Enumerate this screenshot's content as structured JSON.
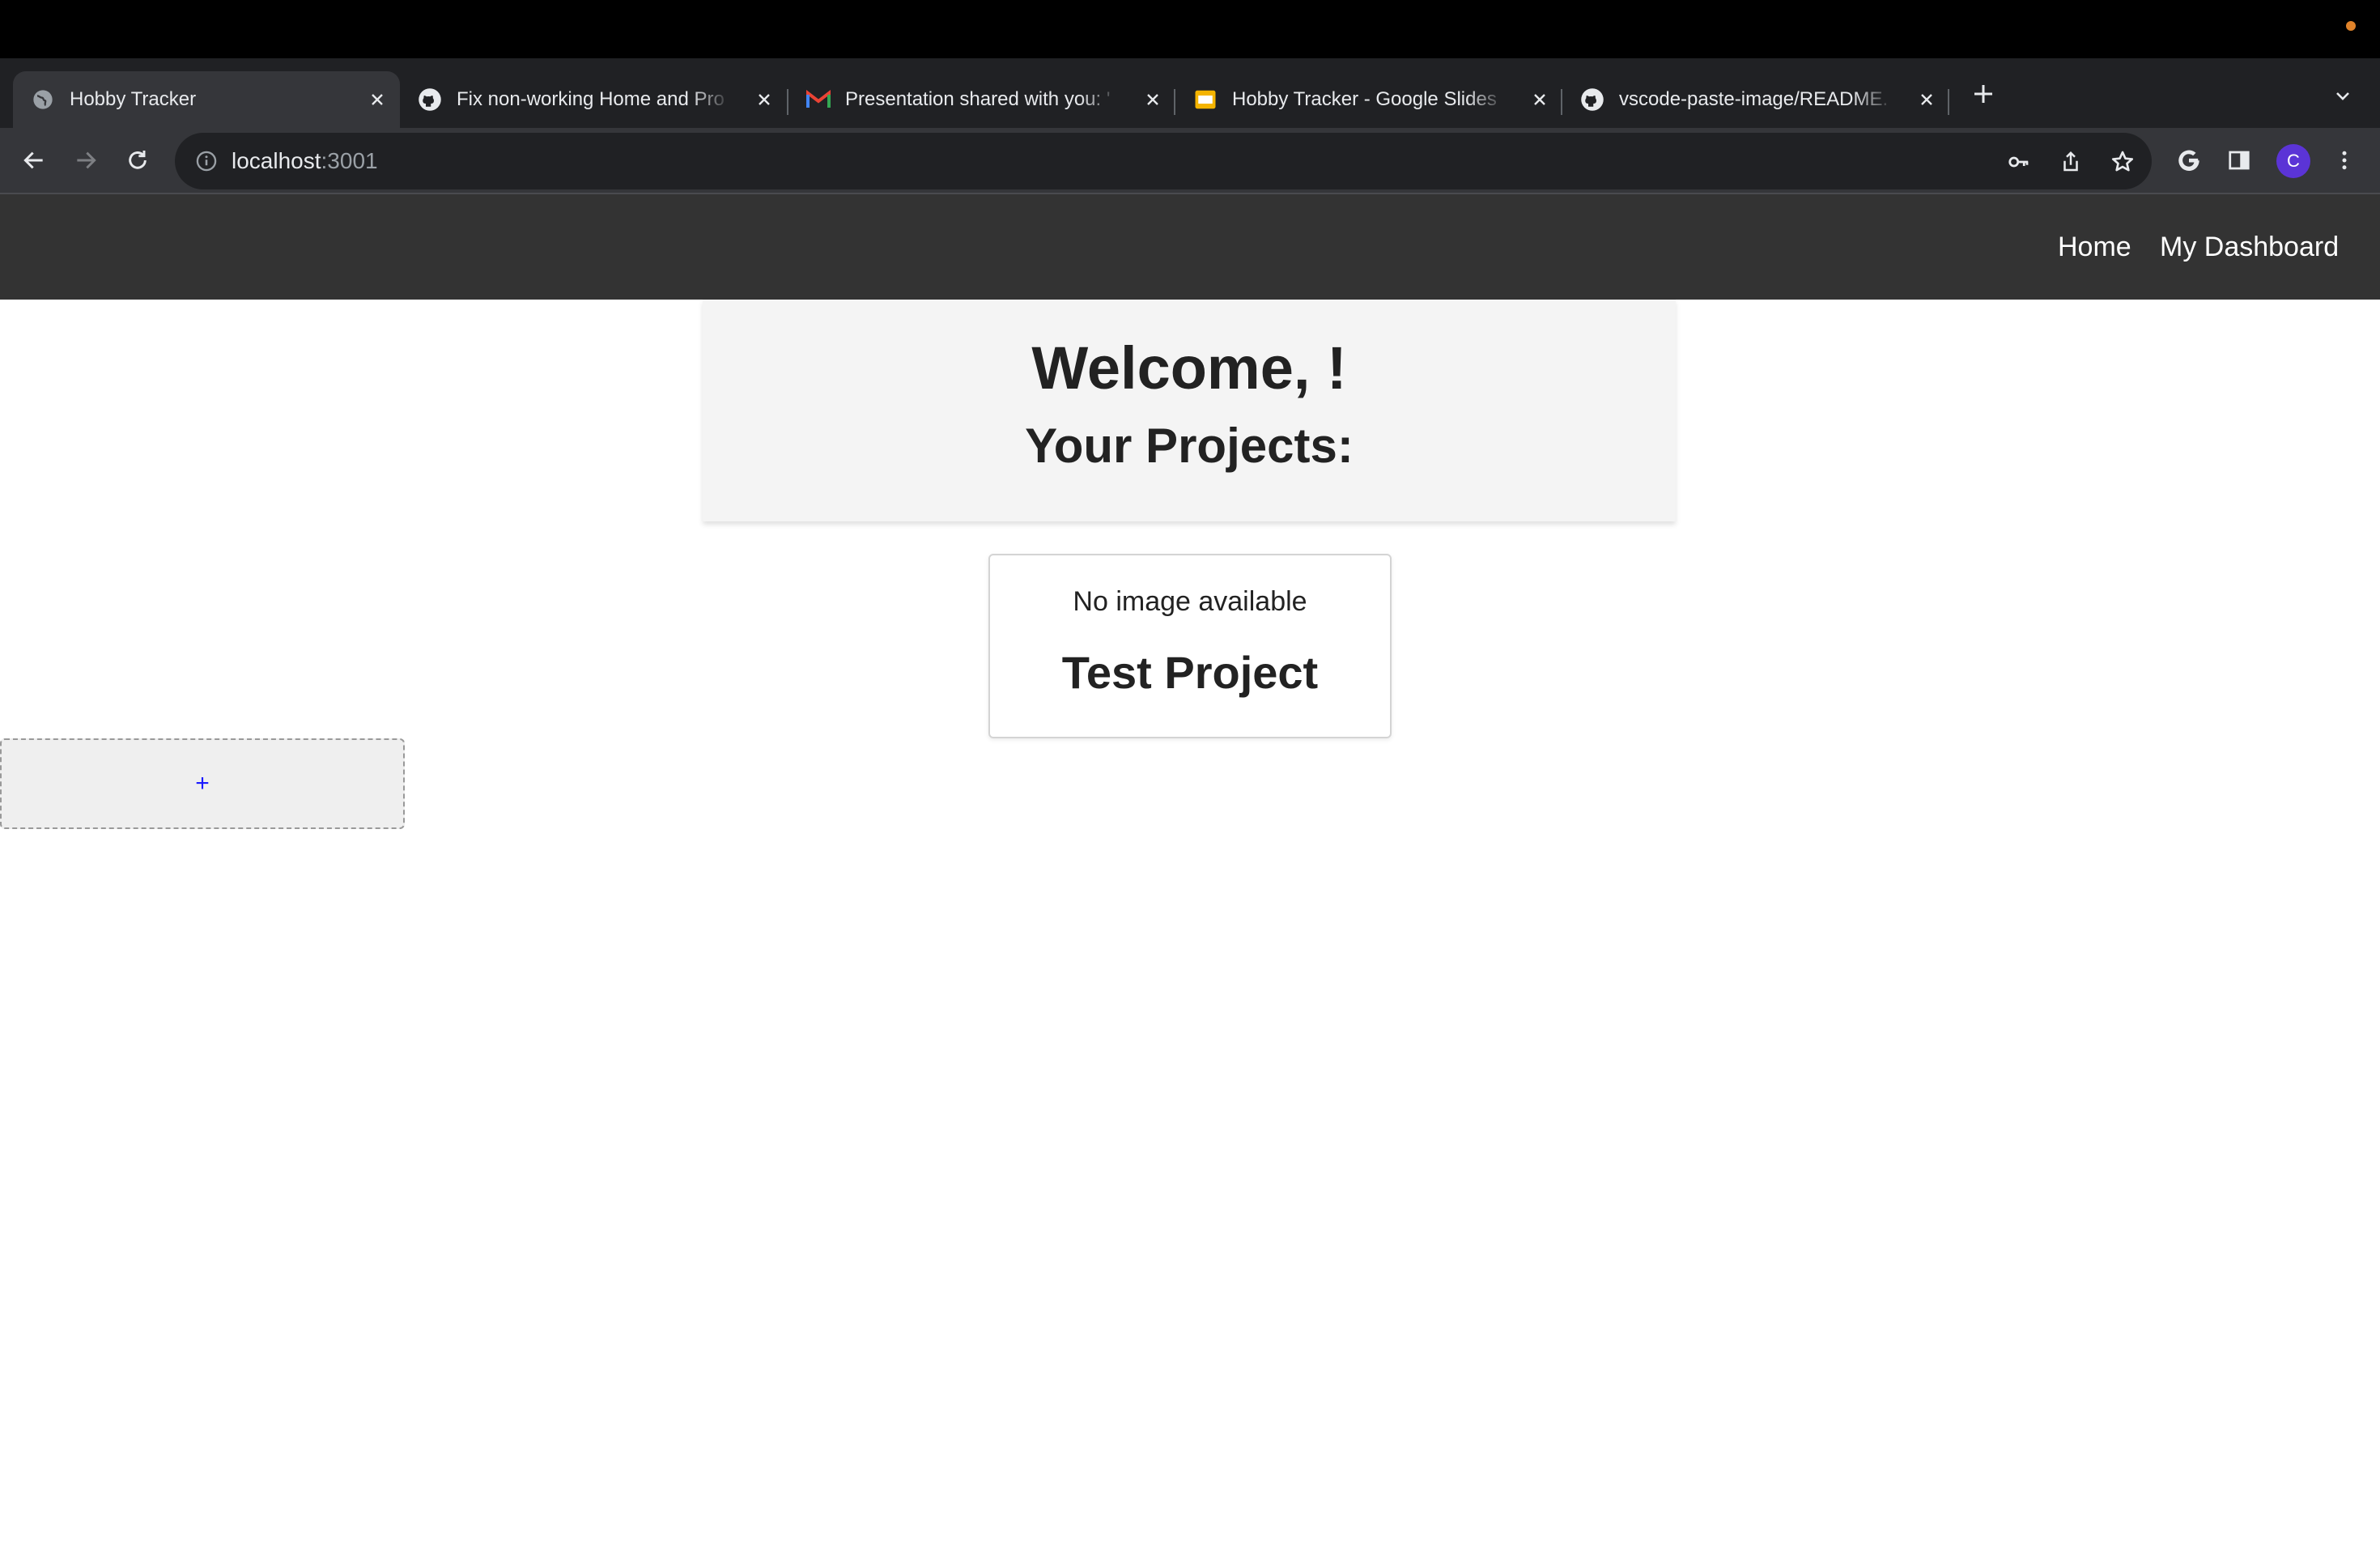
{
  "browser": {
    "tabs": [
      {
        "title": "Hobby Tracker",
        "icon": "globe-icon",
        "active": true
      },
      {
        "title": "Fix non-working Home and Pro",
        "icon": "github-icon",
        "active": false
      },
      {
        "title": "Presentation shared with you: '",
        "icon": "gmail-icon",
        "active": false
      },
      {
        "title": "Hobby Tracker - Google Slides",
        "icon": "slides-icon",
        "active": false
      },
      {
        "title": "vscode-paste-image/README.",
        "icon": "github-icon",
        "active": false
      }
    ],
    "url_host": "localhost",
    "url_port": ":3001",
    "profile_initial": "C",
    "accent_color": "#5b34d6"
  },
  "nav": {
    "home_label": "Home",
    "dashboard_label": "My Dashboard"
  },
  "main": {
    "welcome_title": "Welcome, !",
    "projects_heading": "Your Projects:",
    "projects": [
      {
        "image_placeholder": "No image available",
        "title": "Test Project"
      }
    ],
    "add_label": "+"
  }
}
